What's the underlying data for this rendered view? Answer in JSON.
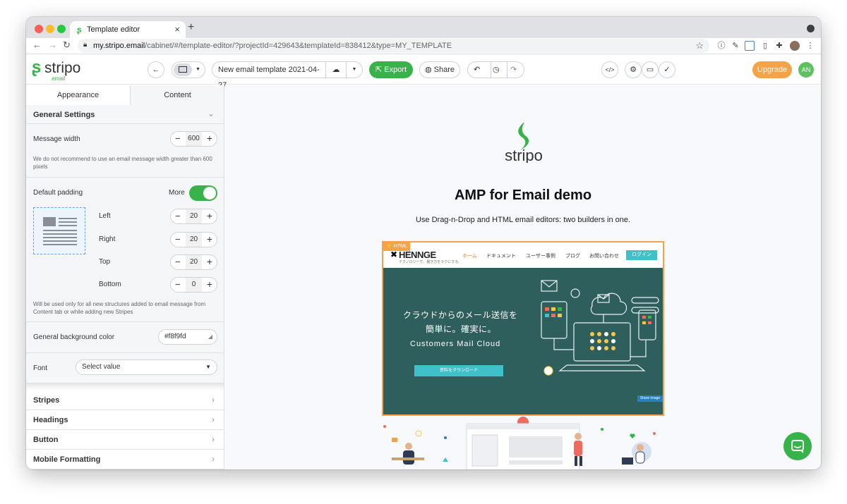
{
  "browser": {
    "tab_title": "Template editor",
    "new_tab": "+",
    "close_tab": "×",
    "url_host": "my.stripo.email",
    "url_path": "/cabinet/#/template-editor/?projectId=429643&templateId=838412&type=MY_TEMPLATE"
  },
  "header": {
    "logo_word": "stripo",
    "logo_sub": ".email",
    "template_name": "New email template 2021-04-27",
    "export_label": "Export",
    "share_label": "Share",
    "upgrade_label": "Upgrade",
    "avatar_initials": "AN"
  },
  "panel": {
    "tabs": [
      "Appearance",
      "Content"
    ],
    "general_settings": "General Settings",
    "message_width_label": "Message width",
    "message_width_value": "600",
    "message_width_note": "We do not recommend to use an email message width greater than 600 pixels",
    "default_padding_label": "Default padding",
    "more_label": "More",
    "padding": [
      {
        "label": "Left",
        "value": "20"
      },
      {
        "label": "Right",
        "value": "20"
      },
      {
        "label": "Top",
        "value": "20"
      },
      {
        "label": "Bottom",
        "value": "0"
      }
    ],
    "padding_note": "Will be used only for all new structures added to email message from Content tab or while adding new Stripes",
    "bg_color_label": "General background color",
    "bg_color_value": "#f8f9fd",
    "font_label": "Font",
    "font_placeholder": "Select value",
    "sections": [
      "Stripes",
      "Headings",
      "Button",
      "Mobile Formatting"
    ]
  },
  "email": {
    "title": "AMP for Email demo",
    "subtitle": "Use Drag-n-Drop and HTML email editors: two builders in one.",
    "banner": {
      "tag": "HTML",
      "brand": "HENNGE",
      "brand_sub": "テクノロジーで、働き方をラクにする。",
      "nav": [
        "ホーム",
        "ドキュメント",
        "ユーザー事例",
        "ブログ",
        "お問い合わせ"
      ],
      "login": "ログイン",
      "headline_1": "クラウドからのメール送信を",
      "headline_2": "簡単に。確実に。",
      "product": "Customers Mail Cloud",
      "download": "資料をダウンロード",
      "share_image": "Share image"
    }
  },
  "colors": {
    "accent_green": "#37b34a",
    "upgrade_orange": "#f5a347",
    "banner_border": "#f3a449",
    "banner_bg": "#2f5f5d",
    "canvas_bg": "#f8f9fd"
  }
}
